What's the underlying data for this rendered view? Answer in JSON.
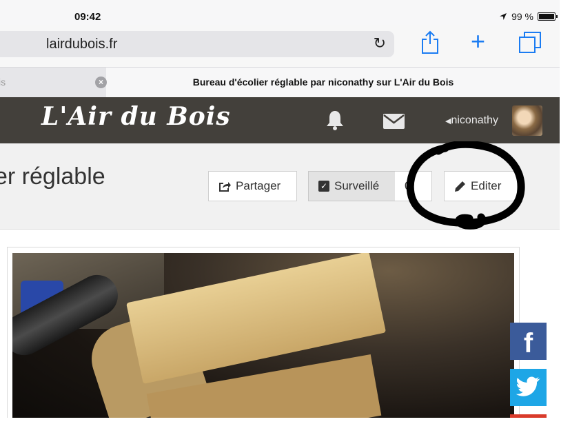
{
  "status_bar": {
    "time": "09:42",
    "battery_percent": "99 %"
  },
  "browser": {
    "url": "lairdubois.fr",
    "tabs": [
      {
        "label": "is",
        "active": false
      },
      {
        "label": "Bureau d'écolier réglable par niconathy sur L'Air du Bois",
        "active": true
      }
    ]
  },
  "site": {
    "logo": "L'Air du Bois",
    "username": "niconathy",
    "colors": {
      "header_bg": "#43403b",
      "facebook": "#3b5b9a",
      "twitter": "#1ea6e6"
    }
  },
  "page": {
    "title": "er réglable",
    "buttons": {
      "share": "Partager",
      "watch": "Surveillé",
      "watch_count": "0",
      "edit": "Editer"
    }
  },
  "social": {
    "facebook_letter": "f"
  }
}
